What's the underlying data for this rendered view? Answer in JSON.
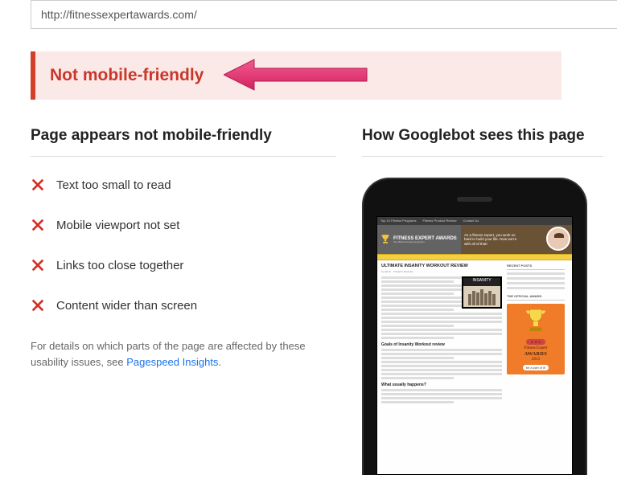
{
  "url_input": "http://fitnessexpertawards.com/",
  "alert": {
    "title": "Not mobile-friendly"
  },
  "left": {
    "heading": "Page appears not mobile-friendly",
    "issues": [
      "Text too small to read",
      "Mobile viewport not set",
      "Links too close together",
      "Content wider than screen"
    ],
    "footnote_pre": "For details on which parts of the page are affected by these usability issues, see ",
    "footnote_link": "Pagespeed Insights",
    "footnote_post": "."
  },
  "right": {
    "heading": "How Googlebot sees this page"
  },
  "preview": {
    "site_name": "FITNESS EXPERT AWARDS",
    "site_tag": "the official annual recognition",
    "hero_quote": "As a fitness expert, you work so hard to build your life. Now we're with all of that!",
    "article_title": "ULTIMATE INSANITY WORKOUT REVIEW",
    "thumb_label": "INSANITY",
    "sidebar_hdr1": "RECENT POSTS",
    "sidebar_hdr2": "THE OFFICIAL AWARD",
    "award_line1": "Fitness Expert",
    "award_line2": "AWARDS",
    "award_year": "2013",
    "award_cta": "be a part of it!",
    "subhead1": "Goals of Insanity Workout review",
    "subhead2": "What usually happens?"
  }
}
